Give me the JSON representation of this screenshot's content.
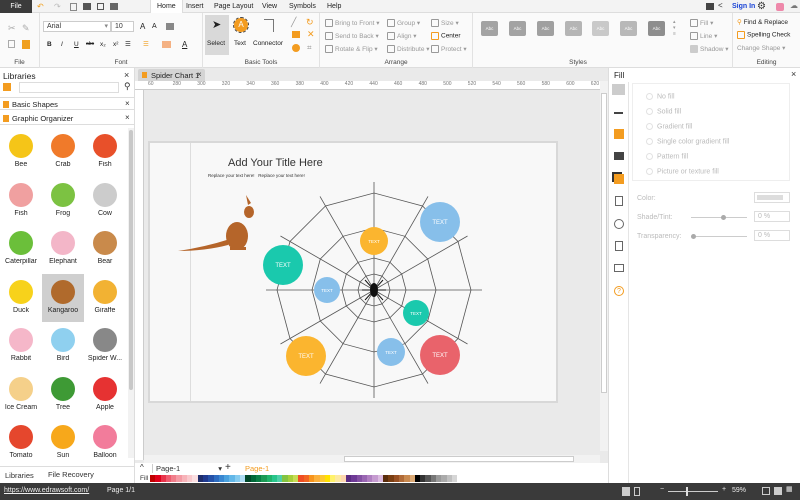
{
  "menu": {
    "file": "File",
    "items": [
      "Home",
      "Insert",
      "Page Layout",
      "View",
      "Symbols",
      "Help"
    ],
    "active": "Home",
    "sign_in": "Sign In"
  },
  "ribbon": {
    "file_group": "File",
    "font": {
      "family": "Arial",
      "size": "10",
      "label": "Font"
    },
    "basic_tools": {
      "select": "Select",
      "text": "Text",
      "connector": "Connector",
      "label": "Basic Tools"
    },
    "arrange": {
      "bring_front": "Bring to Front",
      "send_back": "Send to Back",
      "rotate": "Rotate & Flip",
      "group": "Group",
      "align": "Align",
      "distribute": "Distribute",
      "size": "Size",
      "center": "Center",
      "protect": "Protect",
      "label": "Arrange"
    },
    "styles": {
      "swatch": "Abc",
      "label": "Styles",
      "fill": "Fill",
      "line": "Line",
      "shadow": "Shadow"
    },
    "editing": {
      "find": "Find & Replace",
      "spelling": "Spelling Check",
      "change_shape": "Change Shape",
      "label": "Editing"
    }
  },
  "libraries": {
    "title": "Libraries",
    "search_placeholder": "",
    "sections": [
      "Basic Shapes",
      "Graphic Organizer"
    ],
    "items": [
      {
        "label": "Bee",
        "color": "#f5c518"
      },
      {
        "label": "Crab",
        "color": "#f07a2a"
      },
      {
        "label": "Fish",
        "color": "#e8502a"
      },
      {
        "label": "Fish",
        "color": "#f0a0a0"
      },
      {
        "label": "Frog",
        "color": "#7cc242"
      },
      {
        "label": "Cow",
        "color": "#cccccc"
      },
      {
        "label": "Caterpillar",
        "color": "#6bbf3a"
      },
      {
        "label": "Elephant",
        "color": "#f3b6c8"
      },
      {
        "label": "Bear",
        "color": "#c98a4b"
      },
      {
        "label": "Duck",
        "color": "#f7d21b"
      },
      {
        "label": "Kangaroo",
        "color": "#b06a2c"
      },
      {
        "label": "Giraffe",
        "color": "#f2b233"
      },
      {
        "label": "Rabbit",
        "color": "#f5b7c9"
      },
      {
        "label": "Bird",
        "color": "#8fd0ef"
      },
      {
        "label": "Spider W...",
        "color": "#888888"
      },
      {
        "label": "Ice Cream",
        "color": "#f5d08a"
      },
      {
        "label": "Tree",
        "color": "#3e9a35"
      },
      {
        "label": "Apple",
        "color": "#e63232"
      },
      {
        "label": "Tomato",
        "color": "#e5472d"
      },
      {
        "label": "Sun",
        "color": "#f7a81b"
      },
      {
        "label": "Balloon",
        "color": "#f27c9b"
      }
    ],
    "selected": "Kangaroo",
    "tabs": [
      "Libraries",
      "File Recovery"
    ]
  },
  "document": {
    "tab": "Spider Chart 1",
    "ruler": [
      "60",
      "280",
      "300",
      "320",
      "340",
      "360",
      "380",
      "400",
      "420",
      "440",
      "460",
      "480",
      "500",
      "520",
      "540",
      "560",
      "580",
      "600",
      "620"
    ],
    "title": "Add Your Title Here",
    "subtitle": "Replace your text here!   Replace your text here!",
    "bubbles": [
      {
        "text": "TEXT",
        "color": "#87bfea"
      },
      {
        "text": "TEXT",
        "color": "#fbb52f"
      },
      {
        "text": "TEXT",
        "color": "#1ac9ad"
      },
      {
        "text": "TEXT",
        "color": "#87bfea"
      },
      {
        "text": "TEXT",
        "color": "#1ac9ad"
      },
      {
        "text": "TEXT",
        "color": "#fbb52f"
      },
      {
        "text": "TEXT",
        "color": "#87bfea"
      },
      {
        "text": "TEXT",
        "color": "#e9636b"
      }
    ]
  },
  "pages": {
    "current": "Page-1",
    "tab": "Page-1",
    "fill_label": "Fill"
  },
  "palette": [
    "#c00000",
    "#e0001b",
    "#e8334a",
    "#ee5b6e",
    "#f07d8a",
    "#f49aa4",
    "#f7b3b9",
    "#f9c9cd",
    "#fbdfe1",
    "#1f2d6b",
    "#203a8f",
    "#2551a8",
    "#2d6cc0",
    "#3987d1",
    "#4aa1de",
    "#62b7e8",
    "#84cbef",
    "#aedcf4",
    "#00482a",
    "#006838",
    "#0a7f46",
    "#1c9a55",
    "#21b36b",
    "#29c58c",
    "#4fd0a9",
    "#84c441",
    "#a6cf3a",
    "#c6dc55",
    "#f04e23",
    "#f26522",
    "#f7941d",
    "#fbb03b",
    "#fdc82f",
    "#ffe100",
    "#fff26b",
    "#fde9a0",
    "#fdd7b0",
    "#5b2c83",
    "#6e3a96",
    "#8451a3",
    "#9966b2",
    "#b07fc1",
    "#c59bd0",
    "#dbbbe0",
    "#5a2d0c",
    "#7a3e12",
    "#985023",
    "#b06a37",
    "#c8894f",
    "#dba975",
    "#000000",
    "#333333",
    "#555555",
    "#777777",
    "#999999",
    "#aaaaaa",
    "#c0c0c0",
    "#d6d6d6"
  ],
  "fill_panel": {
    "title": "Fill",
    "options": [
      "No fill",
      "Solid fill",
      "Gradient fill",
      "Single color gradient fill",
      "Pattern fill",
      "Picture or texture fill"
    ],
    "selected": "Solid fill",
    "color_label": "Color:",
    "shade_label": "Shade/Tint:",
    "shade_value": "0 %",
    "shade_level": 0.55,
    "transparency_label": "Transparency:",
    "transparency_value": "0 %",
    "transparency_level": 0
  },
  "status": {
    "url": "https://www.edrawsoft.com/",
    "page": "Page 1/1",
    "zoom": "59%",
    "zoom_level": 0.35
  }
}
